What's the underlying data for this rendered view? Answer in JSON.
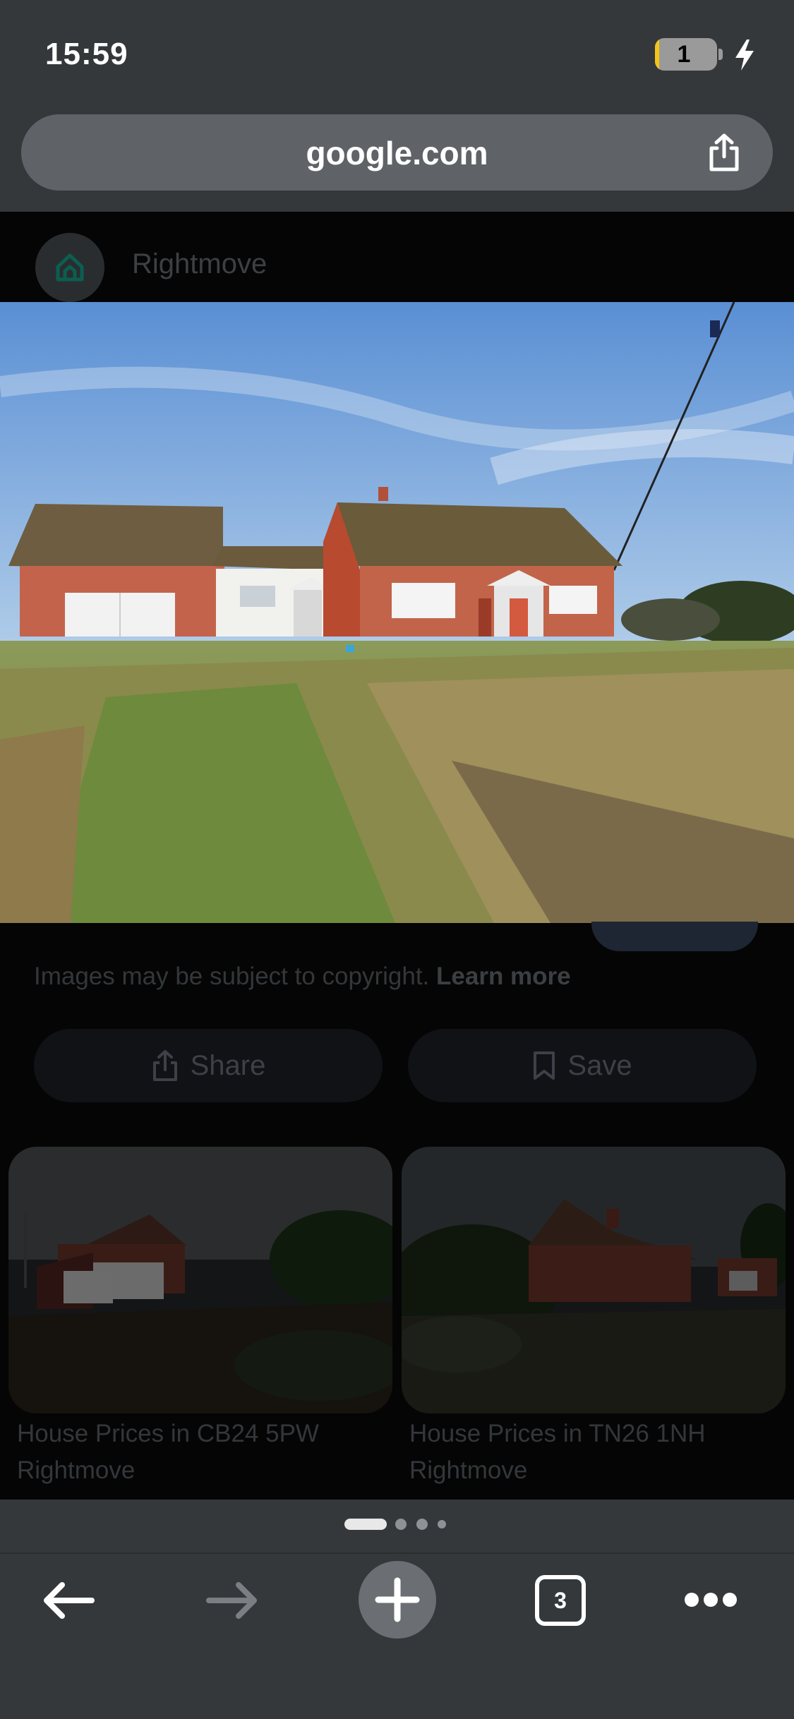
{
  "status_bar": {
    "time": "15:59",
    "battery_level": "1"
  },
  "url_bar": {
    "domain": "google.com"
  },
  "source": {
    "name": "Rightmove"
  },
  "notice": {
    "text": "Images may be subject to copyright.",
    "link": "Learn more"
  },
  "actions": {
    "share": "Share",
    "save": "Save"
  },
  "related": [
    {
      "title": "House Prices in CB24 5PW",
      "source": "Rightmove"
    },
    {
      "title": "House Prices in TN26 1NH",
      "source": "Rightmove"
    }
  ],
  "toolbar": {
    "tab_count": "3"
  },
  "colors": {
    "chrome": "#35383b",
    "url_bar": "#5f6367",
    "battery_fill": "#f2c516"
  }
}
